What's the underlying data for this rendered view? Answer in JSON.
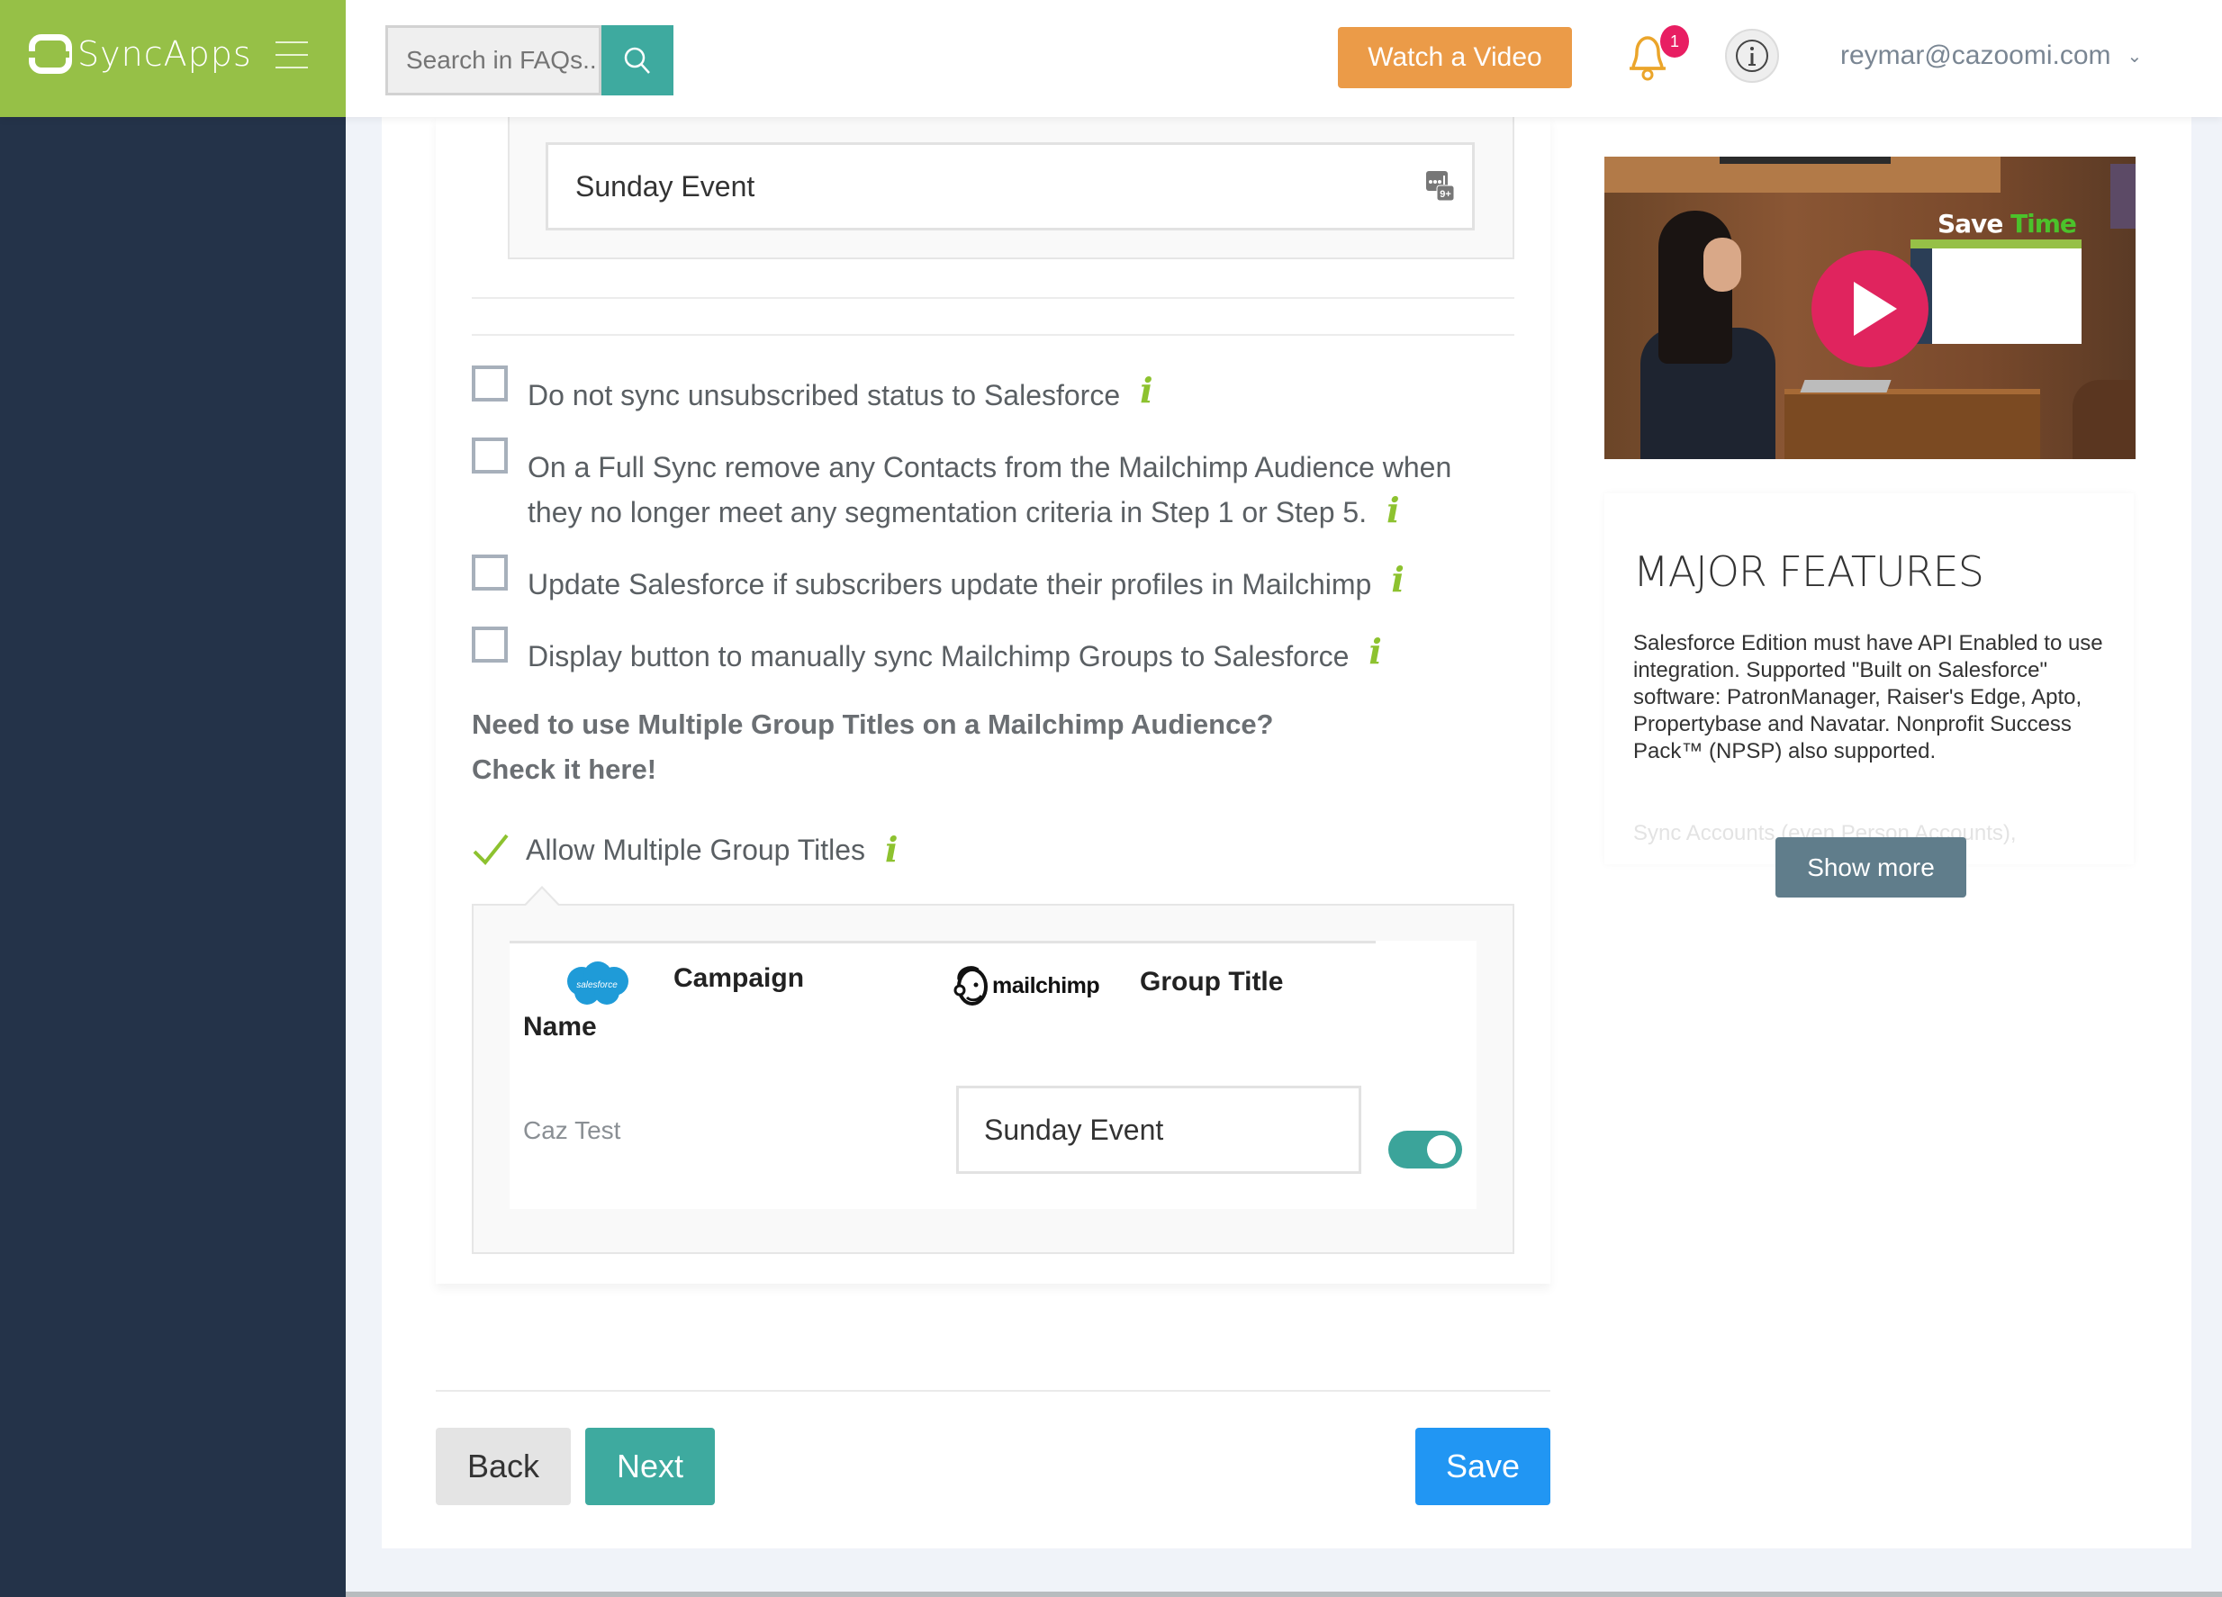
{
  "header": {
    "brand": "SyncApps",
    "search_placeholder": "Search in FAQs..",
    "watch_video_label": "Watch a Video",
    "notification_count": "1",
    "user_email": "reymar@cazoomi.com"
  },
  "group_title_input": {
    "value": "Sunday Event"
  },
  "options": [
    {
      "label": "Do not sync unsubscribed status to Salesforce",
      "checked": false
    },
    {
      "label_line1": "On a Full Sync remove any Contacts from the Mailchimp Audience when",
      "label_line2": "they no longer meet any segmentation criteria in Step 1 or Step 5.",
      "checked": false
    },
    {
      "label": "Update Salesforce if subscribers update their profiles in Mailchimp",
      "checked": false
    },
    {
      "label": "Display button to manually sync Mailchimp Groups to Salesforce",
      "checked": false
    }
  ],
  "multiple_titles": {
    "prompt_line1": "Need to use Multiple Group Titles on a Mailchimp Audience?",
    "prompt_line2": "Check it here!",
    "allow_label": "Allow Multiple Group Titles",
    "allow_checked": true
  },
  "mapping_table": {
    "salesforce_logo_text": "salesforce",
    "col1_label_part1": "Campaign",
    "col1_label_part2": "Name",
    "mailchimp_logo_text": "mailchimp",
    "col2_label": "Group Title",
    "rows": [
      {
        "campaign_name": "Caz Test",
        "group_title": "Sunday Event",
        "enabled": true
      }
    ]
  },
  "footer": {
    "back_label": "Back",
    "next_label": "Next",
    "save_label": "Save"
  },
  "sidebar_right": {
    "video_overlay_word1": "Save",
    "video_overlay_word2": "Time",
    "features_title": "MAJOR FEATURES",
    "features_body": "Salesforce Edition must have API Enabled to use integration. Supported \"Built on Salesforce\" software: PatronManager, Raiser's Edge, Apto, Propertybase and Navatar. Nonprofit Success Pack™ (NPSP) also supported.",
    "features_faded": "Sync Accounts (even Person Accounts),",
    "show_more_label": "Show more"
  },
  "colors": {
    "brand_green": "#96c047",
    "sidebar_navy": "#243349",
    "teal": "#3eaa9f",
    "orange": "#eb9b48",
    "save_blue": "#2196f3",
    "badge_pink": "#e81e62",
    "info_green": "#8dc22f"
  }
}
